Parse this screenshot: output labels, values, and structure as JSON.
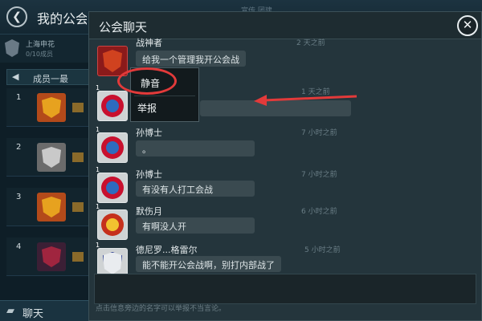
{
  "background": {
    "title": "我的公会",
    "back_icon": "chevron-left-icon",
    "header_hint": "宣传 团建",
    "club": {
      "name": "上海申花",
      "sub": "0/10成员"
    },
    "rank_header": {
      "title": "成员一最",
      "arrow": "◀"
    },
    "ranks": [
      {
        "num": "1",
        "badge_color": "#b34a1a",
        "crest_color": "#e7a21f"
      },
      {
        "num": "2",
        "badge_color": "#6b6b6b",
        "crest_color": "#c9c9c9"
      },
      {
        "num": "3",
        "badge_color": "#b34a1a",
        "crest_color": "#e7a21f"
      },
      {
        "num": "4",
        "badge_color": "#3b1f35",
        "crest_color": "#a0253f"
      }
    ],
    "chat_tab": {
      "label": "聊天",
      "icon": "chat-bubble-icon"
    }
  },
  "dialog": {
    "title": "公会聊天",
    "close_icon": "close-icon",
    "input_hint": "点击信息旁边的名字可以举报不当言论。",
    "messages": [
      {
        "level": "",
        "sender": "战神者",
        "time": "2 天之前",
        "text": "给我一个管理我开公会战",
        "avatar": "red-badge",
        "avatar_color": "#8b1a1a",
        "avatar_inner": "#d0421f"
      },
      {
        "level": "1",
        "sender": "",
        "time": "1 天之前",
        "text": "",
        "avatar": "bayern-crest",
        "avatar_color": "#c8102e",
        "avatar_inner": "#2e6bbf"
      },
      {
        "level": "1",
        "sender": "孙博士",
        "time": "7 小时之前",
        "text": "。",
        "avatar": "bayern-crest",
        "avatar_color": "#c8102e",
        "avatar_inner": "#2e6bbf"
      },
      {
        "level": "1",
        "sender": "孙博士",
        "time": "7 小时之前",
        "text": "有没有人打工会战",
        "avatar": "bayern-crest",
        "avatar_color": "#c8102e",
        "avatar_inner": "#2e6bbf"
      },
      {
        "level": "1",
        "sender": "默伤月",
        "time": "6 小时之前",
        "text": "有啊没人开",
        "avatar": "united-crest",
        "avatar_color": "#c5301c",
        "avatar_inner": "#f2c230"
      },
      {
        "level": "1",
        "sender": "德尼罗...格雷尔",
        "time": "5 小时之前",
        "text": "能不能开公会战啊，别打内部战了",
        "avatar": "white-crest",
        "avatar_color": "#e9ecef",
        "avatar_inner": "#2a3d8f"
      }
    ]
  },
  "context_menu": {
    "items": [
      "静音",
      "举报"
    ]
  },
  "annotation": {
    "highlight_color": "#e23a3a"
  }
}
